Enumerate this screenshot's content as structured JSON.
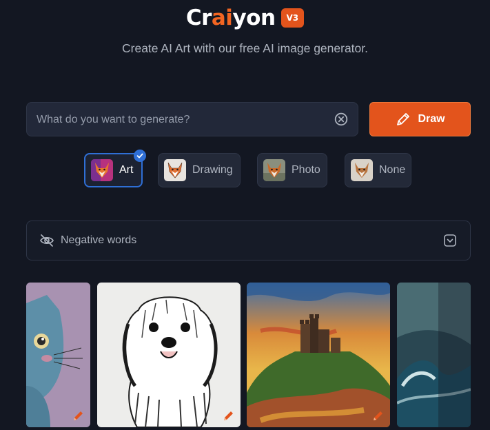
{
  "brand": {
    "name_prefix": "Cr",
    "name_accent": "ai",
    "name_suffix": "yon",
    "version": "V3"
  },
  "tagline": "Create AI Art with our free AI image generator.",
  "search": {
    "placeholder": "What do you want to generate?",
    "value": ""
  },
  "draw_button": {
    "label": "Draw"
  },
  "styles": [
    {
      "label": "Art",
      "selected": true
    },
    {
      "label": "Drawing",
      "selected": false
    },
    {
      "label": "Photo",
      "selected": false
    },
    {
      "label": "None",
      "selected": false
    }
  ],
  "negative_words": {
    "label": "Negative words",
    "expanded": false
  },
  "colors": {
    "background": "#131722",
    "accent": "#e3541c",
    "selection": "#2f6fd6"
  },
  "gallery": [
    {
      "subject": "cartoon cat",
      "icon": "pencil-edit-icon"
    },
    {
      "subject": "ink sketch shaggy dog",
      "icon": "pencil-edit-icon"
    },
    {
      "subject": "impressionist castle on hill",
      "icon": "pencil-edit-icon"
    },
    {
      "subject": "stormy ocean wave",
      "icon": "none"
    }
  ]
}
